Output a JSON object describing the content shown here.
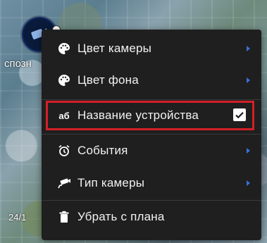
{
  "map": {
    "device_label": "спозн",
    "time_label": "24/1"
  },
  "menu": {
    "items": [
      {
        "label": "Цвет камеры",
        "icon": "palette-icon",
        "has_submenu": true
      },
      {
        "label": "Цвет фона",
        "icon": "palette-icon",
        "has_submenu": true
      },
      {
        "label": "Название устройства",
        "icon": "text-format-icon",
        "icon_text": "аб",
        "checked": true
      },
      {
        "label": "События",
        "icon": "alarm-clock-icon",
        "has_submenu": true
      },
      {
        "label": "Тип камеры",
        "icon": "camera-icon",
        "has_submenu": true
      },
      {
        "label": "Убрать с плана",
        "icon": "trash-icon"
      }
    ]
  },
  "colors": {
    "menu_bg": "#1f1f1f",
    "submenu_arrow": "#3a6fd8",
    "highlight_border": "#d32027",
    "marker_bg": "#0a1a3a"
  }
}
